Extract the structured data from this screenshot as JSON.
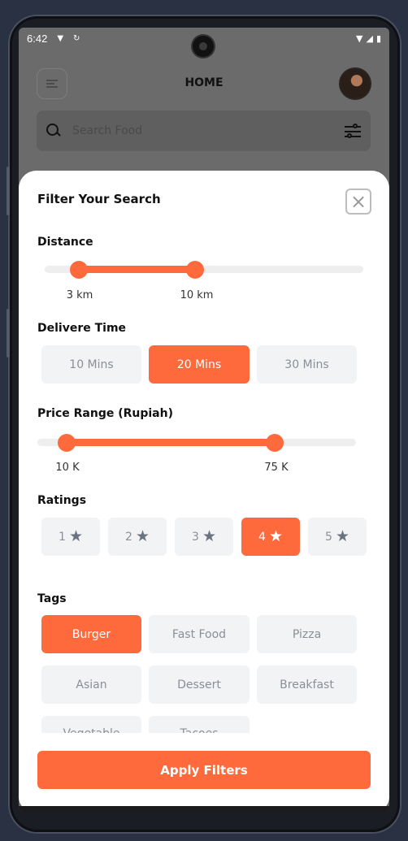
{
  "statusbar": {
    "time": "6:42",
    "left_icons": [
      "location-icon",
      "sync-icon"
    ],
    "right_icons": [
      "wifi-icon",
      "signal-icon",
      "battery-icon"
    ]
  },
  "home": {
    "title": "HOME",
    "search_placeholder": "Search Food"
  },
  "filter": {
    "title": "Filter Your Search",
    "close_label": "×",
    "distance": {
      "label": "Distance",
      "min_label": "3 km",
      "max_label": "10 km",
      "range_fraction": [
        0.1,
        0.47
      ]
    },
    "delivery_time": {
      "label": "Delivere Time",
      "options": [
        "10 Mins",
        "20 Mins",
        "30 Mins"
      ],
      "selected": "20 Mins"
    },
    "price_range": {
      "label": "Price Range (Rupiah)",
      "min_label": "10 K",
      "max_label": "75 K",
      "range_fraction": [
        0.09,
        0.74
      ]
    },
    "ratings": {
      "label": "Ratings",
      "options": [
        "1",
        "2",
        "3",
        "4",
        "5"
      ],
      "selected": "4",
      "icon": "star-icon"
    },
    "tags": {
      "label": "Tags",
      "items": [
        "Burger",
        "Fast Food",
        "Pizza",
        "Asian",
        "Dessert",
        "Breakfast",
        "Vegetable",
        "Tacoes"
      ],
      "selected": [
        "Burger"
      ]
    },
    "apply_label": "Apply Filters"
  },
  "colors": {
    "accent": "#ff6a3d",
    "chip_bg": "#f2f3f5",
    "chip_text": "#8a8f98"
  }
}
